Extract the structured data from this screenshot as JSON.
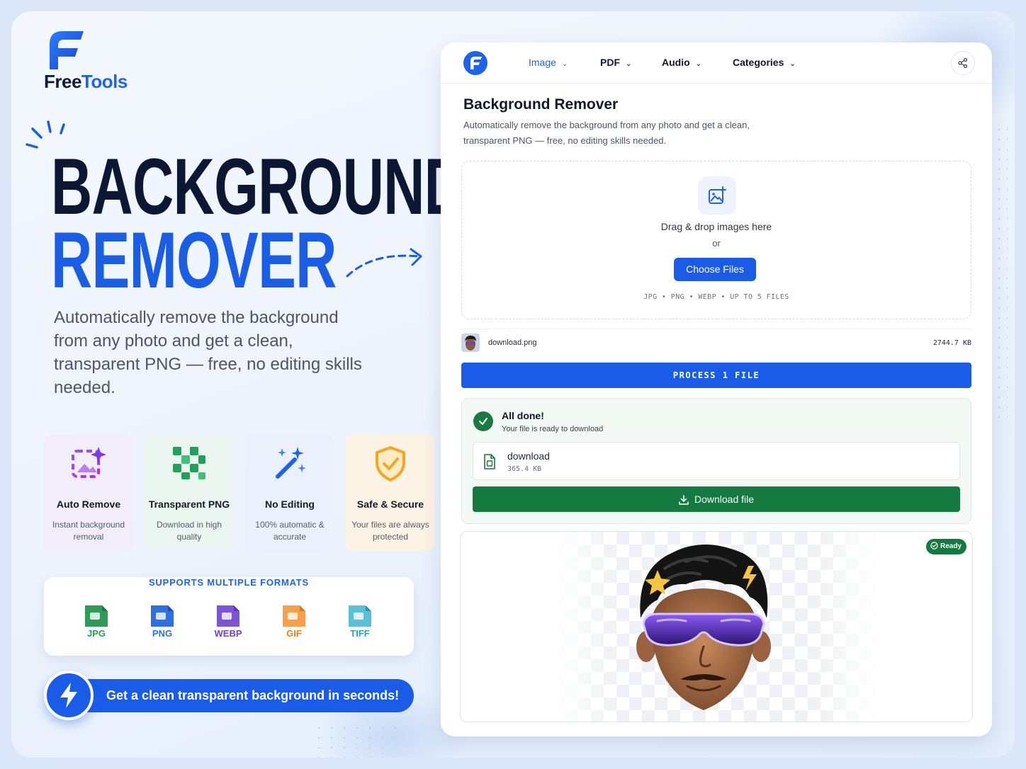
{
  "brand": {
    "name_part1": "Free",
    "name_part2": "Tools"
  },
  "hero": {
    "line1": "BACKGROUND",
    "line2": "REMOVER",
    "description": "Automatically remove the background from any photo and get a clean, transparent PNG — free, no editing skills needed."
  },
  "features": [
    {
      "icon": "sparkle-image-icon",
      "title": "Auto Remove",
      "desc": "Instant background removal",
      "bg": "#f1edfb"
    },
    {
      "icon": "transparent-grid-icon",
      "title": "Transparent PNG",
      "desc": "Download in high quality",
      "bg": "#eaf6ef"
    },
    {
      "icon": "magic-wand-icon",
      "title": "No Editing",
      "desc": "100% automatic & accurate",
      "bg": "#eaf1fc"
    },
    {
      "icon": "shield-check-icon",
      "title": "Safe & Secure",
      "desc": "Your files are always protected",
      "bg": "#fdf3e4"
    }
  ],
  "formats": {
    "title": "SUPPORTS MULTIPLE FORMATS",
    "items": [
      {
        "label": "JPG",
        "color": "#2e9a55"
      },
      {
        "label": "PNG",
        "color": "#2f6fe0"
      },
      {
        "label": "WEBP",
        "color": "#7b55d6"
      },
      {
        "label": "GIF",
        "color": "#f08a2c"
      },
      {
        "label": "TIFF",
        "color": "#3aa6c4"
      }
    ]
  },
  "cta": {
    "text": "Get a clean transparent background in seconds!"
  },
  "app": {
    "nav": {
      "image": "Image",
      "pdf": "PDF",
      "audio": "Audio",
      "categories": "Categories"
    },
    "title": "Background Remover",
    "subtitle": "Automatically remove the background from any photo and get a clean, transparent PNG — free, no editing skills needed.",
    "dropzone": {
      "text": "Drag & drop images here",
      "or": "or",
      "button": "Choose Files",
      "hint": "JPG • PNG • WEBP • UP TO 5 FILES"
    },
    "file": {
      "name": "download.png",
      "size": "2744.7 KB"
    },
    "process_button": "PROCESS 1 FILE",
    "result": {
      "title": "All done!",
      "subtitle": "Your file is ready to download",
      "file_name": "download",
      "file_size": "365.4 KB",
      "download_button": "Download file"
    },
    "preview": {
      "badge": "Ready"
    }
  }
}
